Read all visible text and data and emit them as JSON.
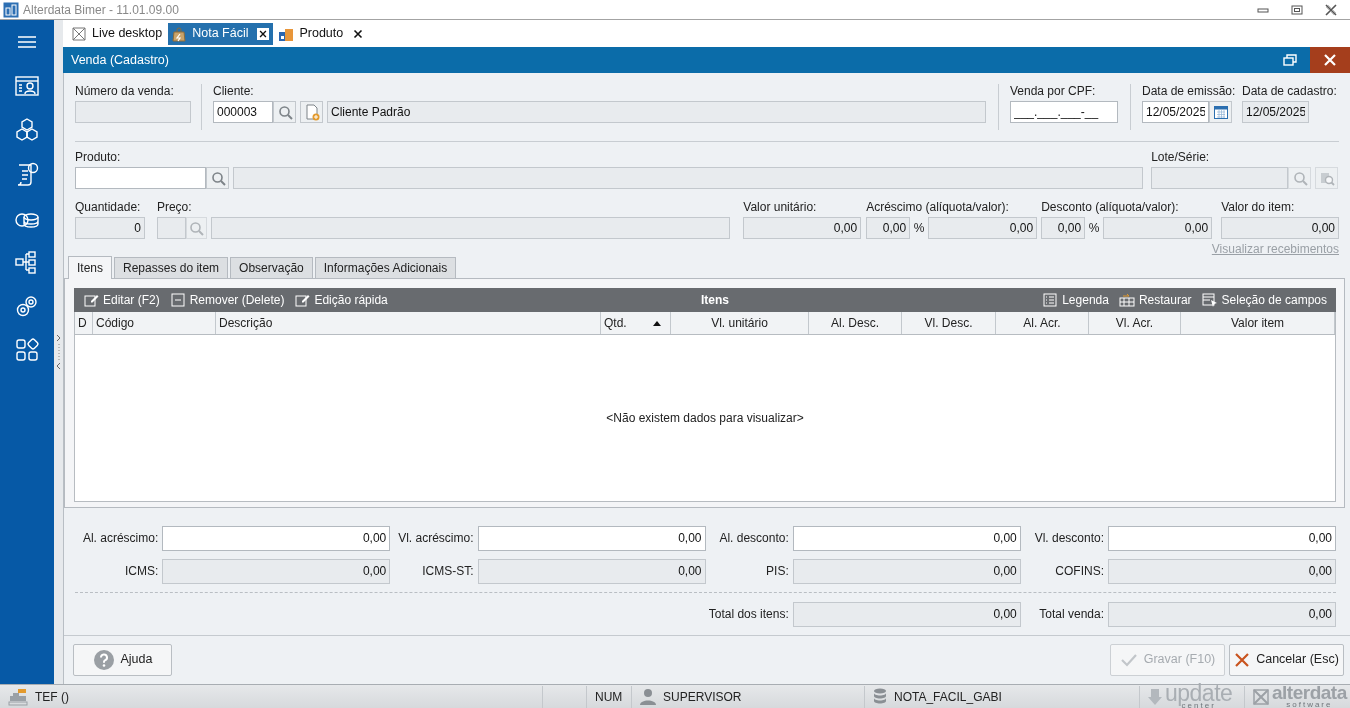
{
  "window": {
    "title": "Alterdata Bimer - 11.01.09.00"
  },
  "doc_tabs": [
    {
      "label": "Live desktop",
      "selected": false,
      "closable": false
    },
    {
      "label": "Nota Fácil",
      "selected": true,
      "closable": true
    },
    {
      "label": "Produto",
      "selected": false,
      "closable": true
    }
  ],
  "form": {
    "title": "Venda (Cadastro)"
  },
  "sale_number": {
    "label": "Número da venda:",
    "disabled": true
  },
  "client": {
    "label": "Cliente:",
    "code": {
      "value": "000003",
      "disabled": false
    },
    "name": {
      "value": "Cliente Padrão",
      "disabled": true
    }
  },
  "cpf": {
    "label": "Venda por CPF:",
    "value": "___.___.___-__",
    "disabled": false
  },
  "issue_date": {
    "label": "Data de emissão:",
    "value": "12/05/2025",
    "disabled": false
  },
  "register_date": {
    "label": "Data de cadastro:",
    "value": "12/05/2025",
    "disabled": true
  },
  "product": {
    "label": "Produto:",
    "code": {
      "disabled": false
    },
    "name": {
      "disabled": true
    }
  },
  "lot": {
    "label": "Lote/Série:",
    "disabled": true
  },
  "quantity": {
    "label": "Quantidade:",
    "value": "0",
    "disabled": true
  },
  "price": {
    "label": "Preço:",
    "code": {
      "disabled": true
    },
    "name": {
      "disabled": true
    }
  },
  "unit_value": {
    "label": "Valor unitário:",
    "value": "0,00",
    "disabled": true
  },
  "surcharge": {
    "label": "Acréscimo (alíquota/valor):",
    "rate": "0,00",
    "percent": "%",
    "amount": "0,00",
    "disabled": true
  },
  "discount": {
    "label": "Desconto (alíquota/valor):",
    "rate": "0,00",
    "percent": "%",
    "amount": "0,00",
    "disabled": true
  },
  "item_value": {
    "label": "Valor do item:",
    "value": "0,00",
    "disabled": true
  },
  "receipts_link": {
    "label": "Visualizar recebimentos",
    "disabled": true
  },
  "tabs": [
    {
      "label": "Itens",
      "selected": true
    },
    {
      "label": "Repasses do item",
      "selected": false
    },
    {
      "label": "Observação",
      "selected": false
    },
    {
      "label": "Informações Adicionais",
      "selected": false
    }
  ],
  "grid": {
    "title": "Itens",
    "left_actions": [
      {
        "label": "Editar (F2)"
      },
      {
        "label": "Remover (Delete)"
      },
      {
        "label": "Edição rápida"
      }
    ],
    "right_actions": [
      {
        "label": "Legenda"
      },
      {
        "label": "Restaurar"
      },
      {
        "label": "Seleção de campos"
      }
    ],
    "columns": [
      {
        "label": "D",
        "sorted_ascending": false
      },
      {
        "label": "Código",
        "sorted_ascending": false
      },
      {
        "label": "Descrição",
        "sorted_ascending": false
      },
      {
        "label": "Qtd.",
        "sorted_ascending": true
      },
      {
        "label": "Vl. unitário",
        "sorted_ascending": false
      },
      {
        "label": "Al. Desc.",
        "sorted_ascending": false
      },
      {
        "label": "Vl. Desc.",
        "sorted_ascending": false
      },
      {
        "label": "Al. Acr.",
        "sorted_ascending": false
      },
      {
        "label": "Vl. Acr.",
        "sorted_ascending": false
      },
      {
        "label": "Valor item",
        "sorted_ascending": false
      }
    ],
    "empty_message": "<Não existem dados para visualizar>"
  },
  "totals": {
    "rows": [
      [
        {
          "label": "Al. acréscimo:",
          "value": "0,00",
          "disabled": false
        },
        {
          "label": "Vl. acréscimo:",
          "value": "0,00",
          "disabled": false
        },
        {
          "label": "Al. desconto:",
          "value": "0,00",
          "disabled": false
        },
        {
          "label": "Vl. desconto:",
          "value": "0,00",
          "disabled": false
        }
      ],
      [
        {
          "label": "ICMS:",
          "value": "0,00",
          "disabled": true
        },
        {
          "label": "ICMS-ST:",
          "value": "0,00",
          "disabled": true
        },
        {
          "label": "PIS:",
          "value": "0,00",
          "disabled": true
        },
        {
          "label": "COFINS:",
          "value": "0,00",
          "disabled": true
        }
      ],
      [
        null,
        null,
        {
          "label": "Total dos itens:",
          "value": "0,00",
          "disabled": true
        },
        {
          "label": "Total venda:",
          "value": "0,00",
          "disabled": true
        }
      ]
    ]
  },
  "buttons": {
    "help": {
      "label": "Ajuda"
    },
    "save": {
      "label": "Gravar (F10)",
      "disabled": true
    },
    "cancel": {
      "label": "Cancelar (Esc)",
      "disabled": false
    }
  },
  "status_bar": {
    "tef": "TEF ()",
    "num": "NUM",
    "user": "SUPERVISOR",
    "database": "NOTA_FACIL_GABI",
    "update_logo": "update",
    "update_sub": "center",
    "alterdata_logo": "alterdata",
    "alterdata_sub": "software"
  }
}
